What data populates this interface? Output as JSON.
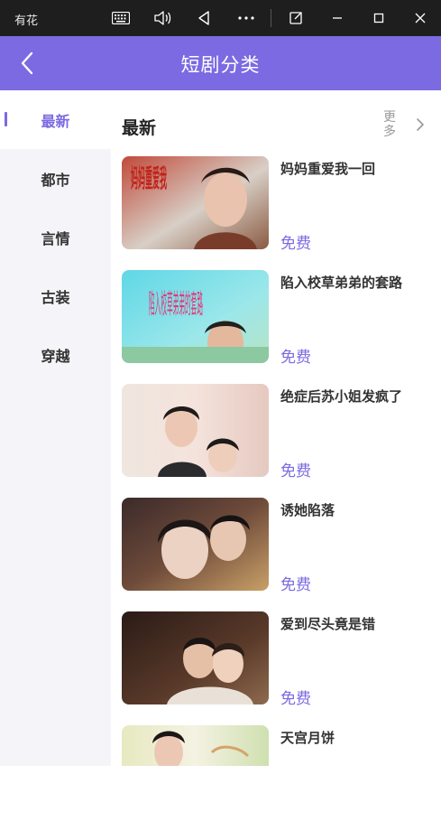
{
  "window": {
    "app_title": "有花"
  },
  "header": {
    "title": "短剧分类"
  },
  "sidebar": {
    "items": [
      {
        "label": "最新",
        "active": true
      },
      {
        "label": "都市",
        "active": false
      },
      {
        "label": "言情",
        "active": false
      },
      {
        "label": "古装",
        "active": false
      },
      {
        "label": "穿越",
        "active": false
      }
    ]
  },
  "main": {
    "section_title": "最新",
    "more_label": "更多",
    "videos": [
      {
        "title": "妈妈重爱我一回",
        "price": "免费",
        "poster_text": "妈妈重爱我"
      },
      {
        "title": "陷入校草弟弟的套路",
        "price": "免费",
        "poster_text": "陷入校草弟弟的套路"
      },
      {
        "title": "绝症后苏小姐发疯了",
        "price": "免费"
      },
      {
        "title": "诱她陷落",
        "price": "免费"
      },
      {
        "title": "爱到尽头竟是错",
        "price": "免费"
      },
      {
        "title": "天宫月饼",
        "price": ""
      }
    ]
  },
  "colors": {
    "accent": "#7b6ae2",
    "sidebar_bg": "#f5f5f9",
    "titlebar_bg": "#1e1e1e"
  }
}
